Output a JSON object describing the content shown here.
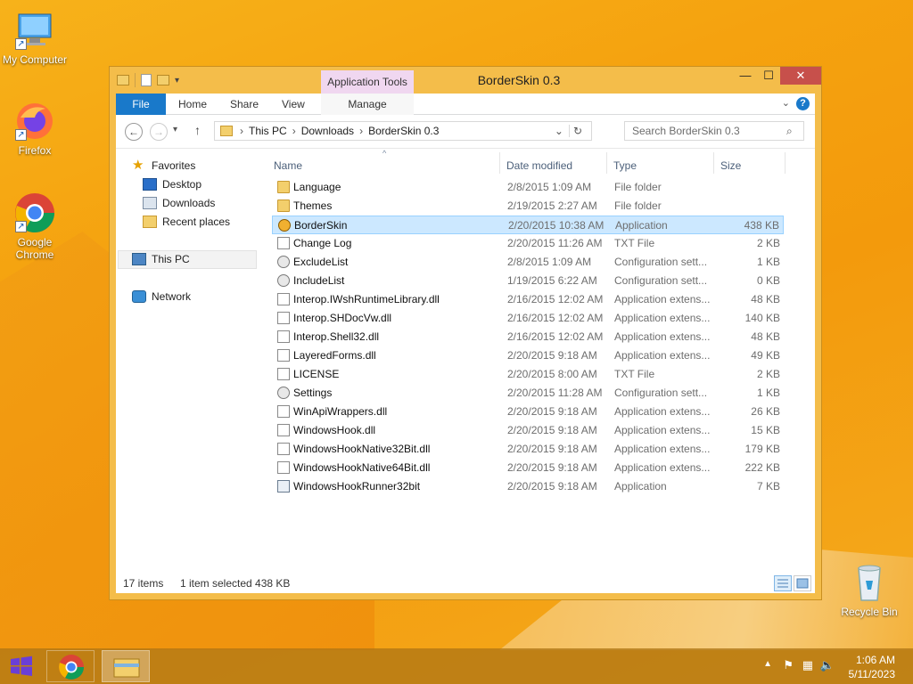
{
  "desktop": {
    "icons": [
      {
        "label": "My Computer"
      },
      {
        "label": "Firefox"
      },
      {
        "label": "Google Chrome"
      },
      {
        "label": "Recycle Bin"
      }
    ]
  },
  "window": {
    "title": "BorderSkin 0.3",
    "contextual_tab_group": "Application Tools",
    "controls": {
      "minimize": "—",
      "maximize": "☐",
      "close": "✕"
    }
  },
  "ribbon": {
    "tabs": [
      "File",
      "Home",
      "Share",
      "View"
    ],
    "contextual_tab": "Manage"
  },
  "address": {
    "breadcrumb": [
      "This PC",
      "Downloads",
      "BorderSkin 0.3"
    ],
    "search_placeholder": "Search BorderSkin 0.3"
  },
  "nav": {
    "favorites": "Favorites",
    "desktop": "Desktop",
    "downloads": "Downloads",
    "recent": "Recent places",
    "this_pc": "This PC",
    "network": "Network"
  },
  "columns": {
    "name": "Name",
    "date": "Date modified",
    "type": "Type",
    "size": "Size"
  },
  "files": [
    {
      "name": "Language",
      "date": "2/8/2015 1:09 AM",
      "type": "File folder",
      "size": "",
      "icon": "folder-icon"
    },
    {
      "name": "Themes",
      "date": "2/19/2015 2:27 AM",
      "type": "File folder",
      "size": "",
      "icon": "folder-icon"
    },
    {
      "name": "BorderSkin",
      "date": "2/20/2015 10:38 AM",
      "type": "Application",
      "size": "438 KB",
      "icon": "app-icon",
      "selected": true
    },
    {
      "name": "Change Log",
      "date": "2/20/2015 11:26 AM",
      "type": "TXT File",
      "size": "2 KB",
      "icon": "text-file-icon"
    },
    {
      "name": "ExcludeList",
      "date": "2/8/2015 1:09 AM",
      "type": "Configuration sett...",
      "size": "1 KB",
      "icon": "config-file-icon"
    },
    {
      "name": "IncludeList",
      "date": "1/19/2015 6:22 AM",
      "type": "Configuration sett...",
      "size": "0 KB",
      "icon": "config-file-icon"
    },
    {
      "name": "Interop.IWshRuntimeLibrary.dll",
      "date": "2/16/2015 12:02 AM",
      "type": "Application extens...",
      "size": "48 KB",
      "icon": "dll-icon"
    },
    {
      "name": "Interop.SHDocVw.dll",
      "date": "2/16/2015 12:02 AM",
      "type": "Application extens...",
      "size": "140 KB",
      "icon": "dll-icon"
    },
    {
      "name": "Interop.Shell32.dll",
      "date": "2/16/2015 12:02 AM",
      "type": "Application extens...",
      "size": "48 KB",
      "icon": "dll-icon"
    },
    {
      "name": "LayeredForms.dll",
      "date": "2/20/2015 9:18 AM",
      "type": "Application extens...",
      "size": "49 KB",
      "icon": "dll-icon"
    },
    {
      "name": "LICENSE",
      "date": "2/20/2015 8:00 AM",
      "type": "TXT File",
      "size": "2 KB",
      "icon": "text-file-icon"
    },
    {
      "name": "Settings",
      "date": "2/20/2015 11:28 AM",
      "type": "Configuration sett...",
      "size": "1 KB",
      "icon": "config-file-icon"
    },
    {
      "name": "WinApiWrappers.dll",
      "date": "2/20/2015 9:18 AM",
      "type": "Application extens...",
      "size": "26 KB",
      "icon": "dll-icon"
    },
    {
      "name": "WindowsHook.dll",
      "date": "2/20/2015 9:18 AM",
      "type": "Application extens...",
      "size": "15 KB",
      "icon": "dll-icon"
    },
    {
      "name": "WindowsHookNative32Bit.dll",
      "date": "2/20/2015 9:18 AM",
      "type": "Application extens...",
      "size": "179 KB",
      "icon": "dll-icon"
    },
    {
      "name": "WindowsHookNative64Bit.dll",
      "date": "2/20/2015 9:18 AM",
      "type": "Application extens...",
      "size": "222 KB",
      "icon": "dll-icon"
    },
    {
      "name": "WindowsHookRunner32bit",
      "date": "2/20/2015 9:18 AM",
      "type": "Application",
      "size": "7 KB",
      "icon": "exe-icon"
    }
  ],
  "status": {
    "count": "17 items",
    "selection": "1 item selected  438 KB"
  },
  "taskbar": {
    "time": "1:06 AM",
    "date": "5/11/2023"
  },
  "colors": {
    "accent": "#1979ca",
    "window_frame": "#f4bd4a",
    "selection": "#cce8ff"
  }
}
